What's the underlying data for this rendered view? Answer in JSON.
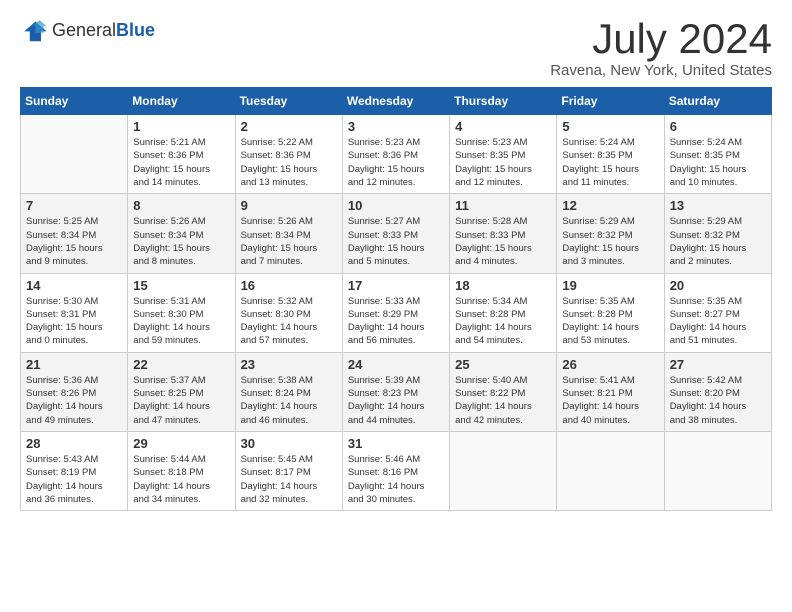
{
  "header": {
    "logo_general": "General",
    "logo_blue": "Blue",
    "month_title": "July 2024",
    "location": "Ravena, New York, United States"
  },
  "days_of_week": [
    "Sunday",
    "Monday",
    "Tuesday",
    "Wednesday",
    "Thursday",
    "Friday",
    "Saturday"
  ],
  "weeks": [
    [
      {
        "day": "",
        "info": ""
      },
      {
        "day": "1",
        "info": "Sunrise: 5:21 AM\nSunset: 8:36 PM\nDaylight: 15 hours\nand 14 minutes."
      },
      {
        "day": "2",
        "info": "Sunrise: 5:22 AM\nSunset: 8:36 PM\nDaylight: 15 hours\nand 13 minutes."
      },
      {
        "day": "3",
        "info": "Sunrise: 5:23 AM\nSunset: 8:36 PM\nDaylight: 15 hours\nand 12 minutes."
      },
      {
        "day": "4",
        "info": "Sunrise: 5:23 AM\nSunset: 8:35 PM\nDaylight: 15 hours\nand 12 minutes."
      },
      {
        "day": "5",
        "info": "Sunrise: 5:24 AM\nSunset: 8:35 PM\nDaylight: 15 hours\nand 11 minutes."
      },
      {
        "day": "6",
        "info": "Sunrise: 5:24 AM\nSunset: 8:35 PM\nDaylight: 15 hours\nand 10 minutes."
      }
    ],
    [
      {
        "day": "7",
        "info": "Sunrise: 5:25 AM\nSunset: 8:34 PM\nDaylight: 15 hours\nand 9 minutes."
      },
      {
        "day": "8",
        "info": "Sunrise: 5:26 AM\nSunset: 8:34 PM\nDaylight: 15 hours\nand 8 minutes."
      },
      {
        "day": "9",
        "info": "Sunrise: 5:26 AM\nSunset: 8:34 PM\nDaylight: 15 hours\nand 7 minutes."
      },
      {
        "day": "10",
        "info": "Sunrise: 5:27 AM\nSunset: 8:33 PM\nDaylight: 15 hours\nand 5 minutes."
      },
      {
        "day": "11",
        "info": "Sunrise: 5:28 AM\nSunset: 8:33 PM\nDaylight: 15 hours\nand 4 minutes."
      },
      {
        "day": "12",
        "info": "Sunrise: 5:29 AM\nSunset: 8:32 PM\nDaylight: 15 hours\nand 3 minutes."
      },
      {
        "day": "13",
        "info": "Sunrise: 5:29 AM\nSunset: 8:32 PM\nDaylight: 15 hours\nand 2 minutes."
      }
    ],
    [
      {
        "day": "14",
        "info": "Sunrise: 5:30 AM\nSunset: 8:31 PM\nDaylight: 15 hours\nand 0 minutes."
      },
      {
        "day": "15",
        "info": "Sunrise: 5:31 AM\nSunset: 8:30 PM\nDaylight: 14 hours\nand 59 minutes."
      },
      {
        "day": "16",
        "info": "Sunrise: 5:32 AM\nSunset: 8:30 PM\nDaylight: 14 hours\nand 57 minutes."
      },
      {
        "day": "17",
        "info": "Sunrise: 5:33 AM\nSunset: 8:29 PM\nDaylight: 14 hours\nand 56 minutes."
      },
      {
        "day": "18",
        "info": "Sunrise: 5:34 AM\nSunset: 8:28 PM\nDaylight: 14 hours\nand 54 minutes."
      },
      {
        "day": "19",
        "info": "Sunrise: 5:35 AM\nSunset: 8:28 PM\nDaylight: 14 hours\nand 53 minutes."
      },
      {
        "day": "20",
        "info": "Sunrise: 5:35 AM\nSunset: 8:27 PM\nDaylight: 14 hours\nand 51 minutes."
      }
    ],
    [
      {
        "day": "21",
        "info": "Sunrise: 5:36 AM\nSunset: 8:26 PM\nDaylight: 14 hours\nand 49 minutes."
      },
      {
        "day": "22",
        "info": "Sunrise: 5:37 AM\nSunset: 8:25 PM\nDaylight: 14 hours\nand 47 minutes."
      },
      {
        "day": "23",
        "info": "Sunrise: 5:38 AM\nSunset: 8:24 PM\nDaylight: 14 hours\nand 46 minutes."
      },
      {
        "day": "24",
        "info": "Sunrise: 5:39 AM\nSunset: 8:23 PM\nDaylight: 14 hours\nand 44 minutes."
      },
      {
        "day": "25",
        "info": "Sunrise: 5:40 AM\nSunset: 8:22 PM\nDaylight: 14 hours\nand 42 minutes."
      },
      {
        "day": "26",
        "info": "Sunrise: 5:41 AM\nSunset: 8:21 PM\nDaylight: 14 hours\nand 40 minutes."
      },
      {
        "day": "27",
        "info": "Sunrise: 5:42 AM\nSunset: 8:20 PM\nDaylight: 14 hours\nand 38 minutes."
      }
    ],
    [
      {
        "day": "28",
        "info": "Sunrise: 5:43 AM\nSunset: 8:19 PM\nDaylight: 14 hours\nand 36 minutes."
      },
      {
        "day": "29",
        "info": "Sunrise: 5:44 AM\nSunset: 8:18 PM\nDaylight: 14 hours\nand 34 minutes."
      },
      {
        "day": "30",
        "info": "Sunrise: 5:45 AM\nSunset: 8:17 PM\nDaylight: 14 hours\nand 32 minutes."
      },
      {
        "day": "31",
        "info": "Sunrise: 5:46 AM\nSunset: 8:16 PM\nDaylight: 14 hours\nand 30 minutes."
      },
      {
        "day": "",
        "info": ""
      },
      {
        "day": "",
        "info": ""
      },
      {
        "day": "",
        "info": ""
      }
    ]
  ]
}
